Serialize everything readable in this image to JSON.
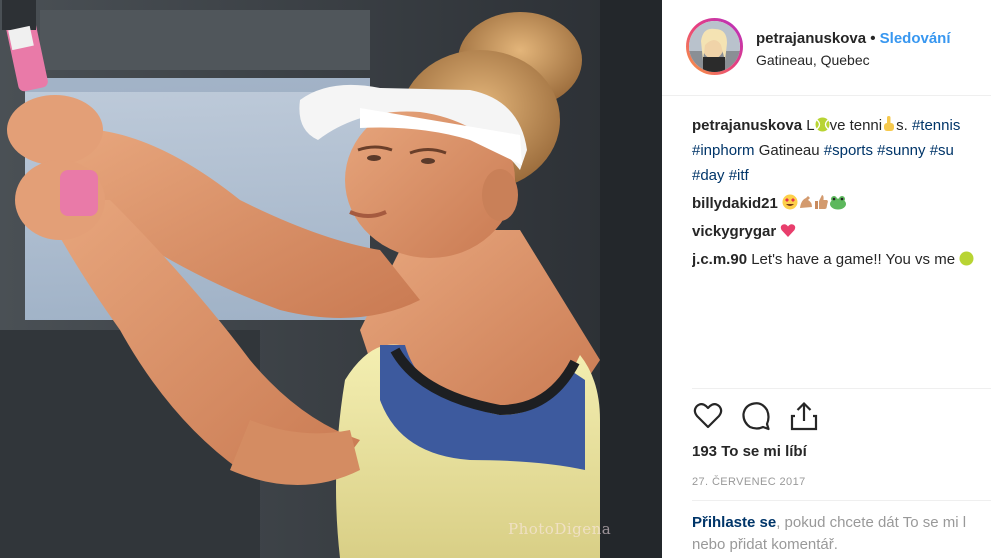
{
  "post": {
    "photo": {
      "description_icon": "tennis-player-photo",
      "watermark": "PhotoDigena"
    },
    "header": {
      "username": "petrajanuskova",
      "separator": "•",
      "follow_label": "Sledování",
      "location": "Gatineau, Quebec"
    },
    "caption": {
      "username": "petrajanuskova",
      "text_part1": "L",
      "text_part2": "ve tenni",
      "text_part3": "s.",
      "hashtag1": "#tennis",
      "hashtag2": "#inphorm",
      "plain1": "Gatineau",
      "hashtag3": "#sports",
      "hashtag4": "#sunny",
      "hashtag5": "#su",
      "hashtag6": "#day",
      "hashtag7": "#itf"
    },
    "comments": [
      {
        "username": "billydakid21",
        "text": ""
      },
      {
        "username": "vickygrygar",
        "text": ""
      },
      {
        "username": "j.c.m.90",
        "text": "Let's have a game!! You vs me"
      }
    ],
    "actions": {
      "like_icon": "heart-icon",
      "comment_icon": "comment-icon",
      "share_icon": "share-icon"
    },
    "likes_text": "193 To se mi líbí",
    "date_text": "27. ČERVENEC 2017",
    "login_prompt": {
      "link": "Přihlaste se",
      "text1": ", pokud chcete dát To se mi l",
      "text2": "nebo přidat komentář."
    },
    "colors": {
      "follow": "#3897f0",
      "hashtag": "#003569",
      "text": "#262626",
      "muted": "#999999"
    }
  }
}
